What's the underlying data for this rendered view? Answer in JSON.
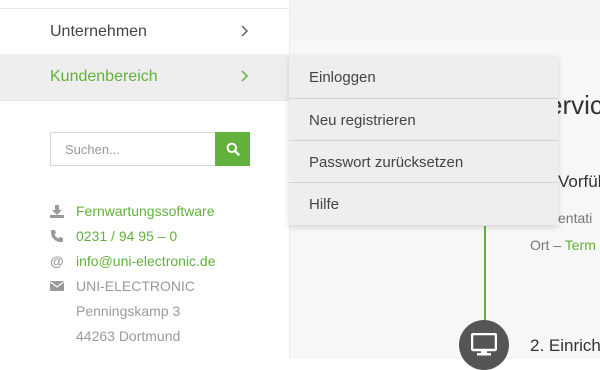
{
  "nav": {
    "items": [
      {
        "label": "Unternehmen",
        "icon": "chevron-right-icon"
      },
      {
        "label": "Kundenbereich",
        "icon": "chevron-right-icon",
        "active": true
      }
    ]
  },
  "search": {
    "placeholder": "Suchen...",
    "button_icon": "search-icon"
  },
  "contact": {
    "download_label": "Fernwartungssoftware",
    "phone": "0231 / 94 95 – 0",
    "email": "info@uni-electronic.de",
    "company": "UNI-ELECTRONIC",
    "street": "Penningskamp 3",
    "city": "44263 Dortmund"
  },
  "dropdown": {
    "items": [
      "Einloggen",
      "Neu registrieren",
      "Passwort zurücksetzen",
      "Hilfe"
    ]
  },
  "content": {
    "heading": "ervic",
    "step1_title": "Vorfüh",
    "step1_text": "entati",
    "step1_text2_prefix": "Ort – ",
    "step1_text2_link": "Term",
    "step2_title": "2. Einrich",
    "step_icon": "monitor-icon"
  },
  "colors": {
    "accent": "#62b13c",
    "text": "#444444",
    "muted": "#9a9a9a",
    "menu_bg": "#eeeeee"
  }
}
